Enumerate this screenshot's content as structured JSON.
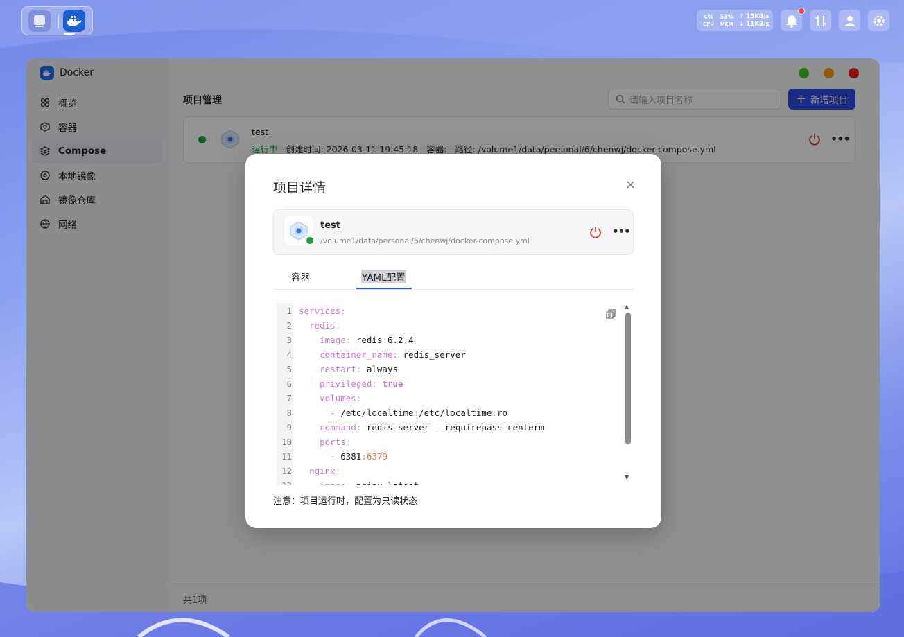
{
  "topbar": {
    "cpu_value": "4%",
    "cpu_label": "CPU",
    "mem_value": "33%",
    "mem_label": "MEM",
    "net_up": "↑ 15KB/s",
    "net_down": "↓ 11KB/s"
  },
  "app": {
    "title": "Docker"
  },
  "sidebar": {
    "items": [
      {
        "label": "概览",
        "icon": "overview-icon"
      },
      {
        "label": "容器",
        "icon": "container-icon"
      },
      {
        "label": "Compose",
        "icon": "layers-icon",
        "active": true
      },
      {
        "label": "本地镜像",
        "icon": "disc-icon"
      },
      {
        "label": "镜像仓库",
        "icon": "warehouse-icon"
      },
      {
        "label": "网络",
        "icon": "network-icon"
      }
    ]
  },
  "main": {
    "page_title": "项目管理",
    "search_placeholder": "请输入项目名称",
    "add_button": "新增项目",
    "project": {
      "name": "test",
      "status": "运行中",
      "created_label": "创建时间: 2026-03-11 19:45:18",
      "container_label": "容器:",
      "path_label": "路径: /volume1/data/personal/6/chenwj/docker-compose.yml"
    },
    "footer_count": "共1项"
  },
  "modal": {
    "title": "项目详情",
    "close": "×",
    "project_name": "test",
    "project_path": "/volume1/data/personal/6/chenwj/docker-compose.yml",
    "tabs": [
      "容器",
      "YAML配置"
    ],
    "active_tab": "YAML配置",
    "note": "注意：项目运行时，配置为只读状态",
    "yaml_lines": [
      "services:",
      "  redis:",
      "    image: redis:6.2.4",
      "    container_name: redis_server",
      "    restart: always",
      "    privileged: true",
      "    volumes:",
      "      - /etc/localtime:/etc/localtime:ro",
      "    command: redis-server --requirepass centerm",
      "    ports:",
      "      - 6381:6379",
      "  nginx:",
      "    image: nginx:latest"
    ]
  },
  "colors": {
    "accent": "#2f50e8",
    "running": "#18a33b",
    "danger": "#e23b3b",
    "win_green": "#3cc71a",
    "win_orange": "#f59b0b",
    "win_red": "#f01d13"
  }
}
